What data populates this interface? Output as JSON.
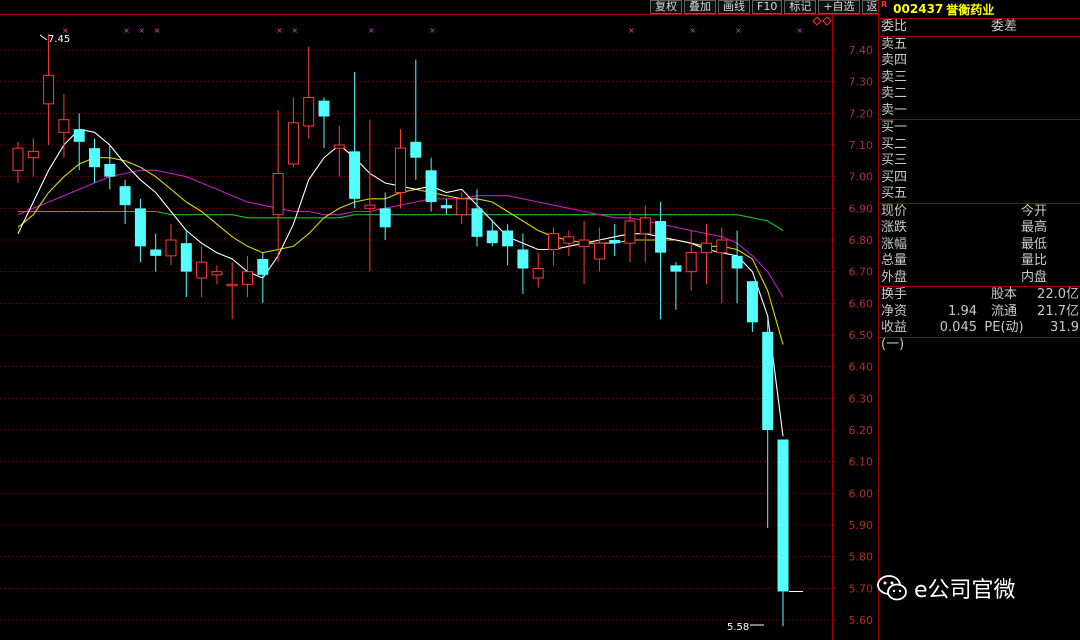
{
  "toolbar": [
    "复权",
    "叠加",
    "画线",
    "F10",
    "标记",
    "+自选",
    "返回"
  ],
  "stock": {
    "marker": "R",
    "code": "002437",
    "name": "誉衡药业"
  },
  "panel": {
    "header": [
      "委比",
      "委差"
    ],
    "sell": [
      "卖五",
      "卖四",
      "卖三",
      "卖二",
      "卖一"
    ],
    "buy": [
      "买一",
      "买二",
      "买三",
      "买四",
      "买五"
    ],
    "quote": [
      [
        "现价",
        "今开"
      ],
      [
        "涨跌",
        "最高"
      ],
      [
        "涨幅",
        "最低"
      ],
      [
        "总量",
        "量比"
      ],
      [
        "外盘",
        "内盘"
      ]
    ],
    "fin": [
      {
        "l1": "换手",
        "v1": "",
        "l2": "股本",
        "v2": "22.0亿"
      },
      {
        "l1": "净资",
        "v1": "1.94",
        "l2": "流通",
        "v2": "21.7亿"
      },
      {
        "l1": "收益(一)",
        "v1": "0.045",
        "l2": "PE(动)",
        "v2": "31.9"
      }
    ]
  },
  "watermark": "e公司官微",
  "chart_data": {
    "type": "candlestick",
    "y_ticks": [
      "7.40",
      "7.30",
      "7.20",
      "7.10",
      "7.00",
      "6.90",
      "6.80",
      "6.70",
      "6.60",
      "6.50",
      "6.40",
      "6.30",
      "6.20",
      "6.10",
      "6.00",
      "5.90",
      "5.80",
      "5.70",
      "5.60"
    ],
    "ylim": [
      5.57,
      7.52
    ],
    "high_label": "7.45",
    "low_label": "5.58",
    "up_color": "#ff3a3a",
    "down_color": "#54ffff",
    "candles": [
      [
        7.02,
        7.09,
        7.11,
        6.98
      ],
      [
        7.06,
        7.08,
        7.12,
        7.0
      ],
      [
        7.23,
        7.32,
        7.45,
        7.1
      ],
      [
        7.14,
        7.18,
        7.26,
        7.06
      ],
      [
        7.15,
        7.11,
        7.2,
        7.02
      ],
      [
        7.09,
        7.03,
        7.12,
        6.98
      ],
      [
        7.04,
        7.0,
        7.1,
        6.96
      ],
      [
        6.97,
        6.91,
        6.99,
        6.85
      ],
      [
        6.9,
        6.78,
        6.93,
        6.73
      ],
      [
        6.77,
        6.75,
        6.82,
        6.7
      ],
      [
        6.75,
        6.8,
        6.85,
        6.72
      ],
      [
        6.79,
        6.7,
        6.83,
        6.62
      ],
      [
        6.68,
        6.73,
        6.78,
        6.62
      ],
      [
        6.69,
        6.7,
        6.72,
        6.66
      ],
      [
        6.66,
        6.66,
        6.73,
        6.55
      ],
      [
        6.66,
        6.7,
        6.75,
        6.62
      ],
      [
        6.74,
        6.69,
        6.76,
        6.6
      ],
      [
        6.88,
        7.01,
        7.21,
        6.73
      ],
      [
        7.04,
        7.17,
        7.25,
        7.03
      ],
      [
        7.16,
        7.25,
        7.41,
        7.12
      ],
      [
        7.24,
        7.19,
        7.25,
        7.09
      ],
      [
        7.09,
        7.1,
        7.16,
        7.0
      ],
      [
        7.08,
        6.93,
        7.33,
        6.9
      ],
      [
        6.9,
        6.91,
        7.18,
        6.7
      ],
      [
        6.9,
        6.84,
        6.95,
        6.8
      ],
      [
        6.95,
        7.09,
        7.15,
        6.9
      ],
      [
        7.11,
        7.06,
        7.37,
        6.99
      ],
      [
        7.02,
        6.92,
        7.06,
        6.89
      ],
      [
        6.91,
        6.9,
        6.93,
        6.88
      ],
      [
        6.88,
        6.93,
        6.95,
        6.85
      ],
      [
        6.9,
        6.81,
        6.96,
        6.78
      ],
      [
        6.83,
        6.79,
        6.86,
        6.78
      ],
      [
        6.83,
        6.78,
        6.85,
        6.72
      ],
      [
        6.77,
        6.71,
        6.82,
        6.63
      ],
      [
        6.68,
        6.71,
        6.76,
        6.65
      ],
      [
        6.77,
        6.82,
        6.84,
        6.72
      ],
      [
        6.79,
        6.81,
        6.83,
        6.75
      ],
      [
        6.78,
        6.8,
        6.86,
        6.66
      ],
      [
        6.74,
        6.79,
        6.84,
        6.7
      ],
      [
        6.8,
        6.79,
        6.85,
        6.75
      ],
      [
        6.79,
        6.86,
        6.89,
        6.73
      ],
      [
        6.82,
        6.87,
        6.91,
        6.73
      ],
      [
        6.86,
        6.76,
        6.92,
        6.55
      ],
      [
        6.72,
        6.7,
        6.73,
        6.58
      ],
      [
        6.7,
        6.76,
        6.83,
        6.64
      ],
      [
        6.76,
        6.79,
        6.85,
        6.66
      ],
      [
        6.76,
        6.8,
        6.84,
        6.6
      ],
      [
        6.75,
        6.71,
        6.83,
        6.6
      ],
      [
        6.67,
        6.54,
        6.67,
        6.51
      ],
      [
        6.51,
        6.2,
        6.55,
        5.89
      ],
      [
        6.17,
        5.69,
        6.17,
        5.58
      ]
    ],
    "ma5": [
      6.82,
      6.92,
      7.02,
      7.1,
      7.15,
      7.14,
      7.1,
      7.04,
      6.99,
      6.95,
      6.89,
      6.83,
      6.79,
      6.76,
      6.74,
      6.7,
      6.68,
      6.75,
      6.85,
      6.99,
      7.06,
      7.1,
      7.06,
      7.01,
      6.98,
      6.97,
      6.96,
      6.97,
      6.95,
      6.96,
      6.91,
      6.86,
      6.81,
      6.79,
      6.77,
      6.77,
      6.78,
      6.79,
      6.8,
      6.81,
      6.82,
      6.82,
      6.81,
      6.8,
      6.79,
      6.77,
      6.76,
      6.75,
      6.7,
      6.56,
      6.18
    ],
    "ma10": [
      6.84,
      6.88,
      6.95,
      7.0,
      7.04,
      7.06,
      7.06,
      7.05,
      7.03,
      7.0,
      6.96,
      6.92,
      6.89,
      6.85,
      6.81,
      6.78,
      6.76,
      6.77,
      6.78,
      6.82,
      6.87,
      6.9,
      6.92,
      6.93,
      6.93,
      6.95,
      6.96,
      6.95,
      6.94,
      6.93,
      6.93,
      6.92,
      6.89,
      6.86,
      6.83,
      6.81,
      6.8,
      6.79,
      6.79,
      6.79,
      6.8,
      6.8,
      6.8,
      6.8,
      6.79,
      6.78,
      6.78,
      6.77,
      6.74,
      6.64,
      6.47
    ],
    "ma20": [
      6.88,
      6.9,
      6.92,
      6.94,
      6.96,
      6.98,
      7.0,
      7.01,
      7.02,
      7.02,
      7.01,
      7.0,
      6.98,
      6.96,
      6.94,
      6.92,
      6.91,
      6.9,
      6.89,
      6.89,
      6.88,
      6.88,
      6.89,
      6.89,
      6.9,
      6.91,
      6.92,
      6.93,
      6.93,
      6.93,
      6.94,
      6.94,
      6.94,
      6.93,
      6.92,
      6.91,
      6.9,
      6.89,
      6.88,
      6.87,
      6.87,
      6.86,
      6.85,
      6.84,
      6.83,
      6.82,
      6.81,
      6.79,
      6.75,
      6.7,
      6.62
    ],
    "ma60": [
      6.89,
      6.89,
      6.89,
      6.89,
      6.89,
      6.89,
      6.89,
      6.89,
      6.89,
      6.89,
      6.88,
      6.88,
      6.88,
      6.88,
      6.88,
      6.87,
      6.87,
      6.87,
      6.87,
      6.87,
      6.87,
      6.87,
      6.88,
      6.88,
      6.88,
      6.88,
      6.88,
      6.88,
      6.88,
      6.88,
      6.88,
      6.88,
      6.88,
      6.88,
      6.88,
      6.88,
      6.88,
      6.88,
      6.88,
      6.88,
      6.88,
      6.88,
      6.88,
      6.88,
      6.88,
      6.88,
      6.88,
      6.88,
      6.87,
      6.86,
      6.83
    ],
    "ma_colors": {
      "ma5": "#ffffff",
      "ma10": "#d8d800",
      "ma20": "#c020c0",
      "ma60": "#20c020"
    },
    "markers": [
      3,
      7,
      8,
      9,
      17,
      18,
      23,
      27,
      40,
      44,
      47,
      51
    ]
  }
}
